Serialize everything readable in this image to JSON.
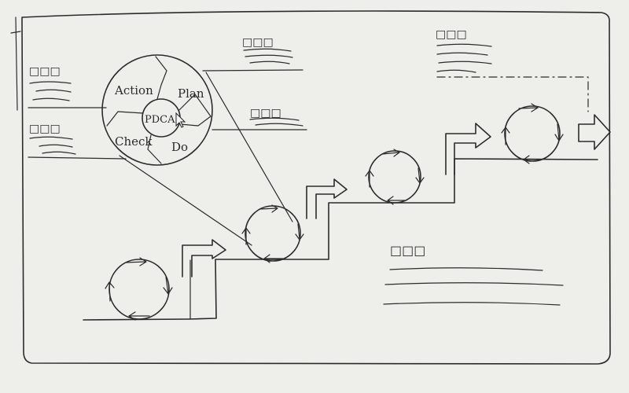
{
  "pdca": {
    "center": "PDCA",
    "segments": [
      "Action",
      "Plan",
      "Check",
      "Do"
    ]
  },
  "placeholder_boxes": "□□□",
  "steps": 5
}
